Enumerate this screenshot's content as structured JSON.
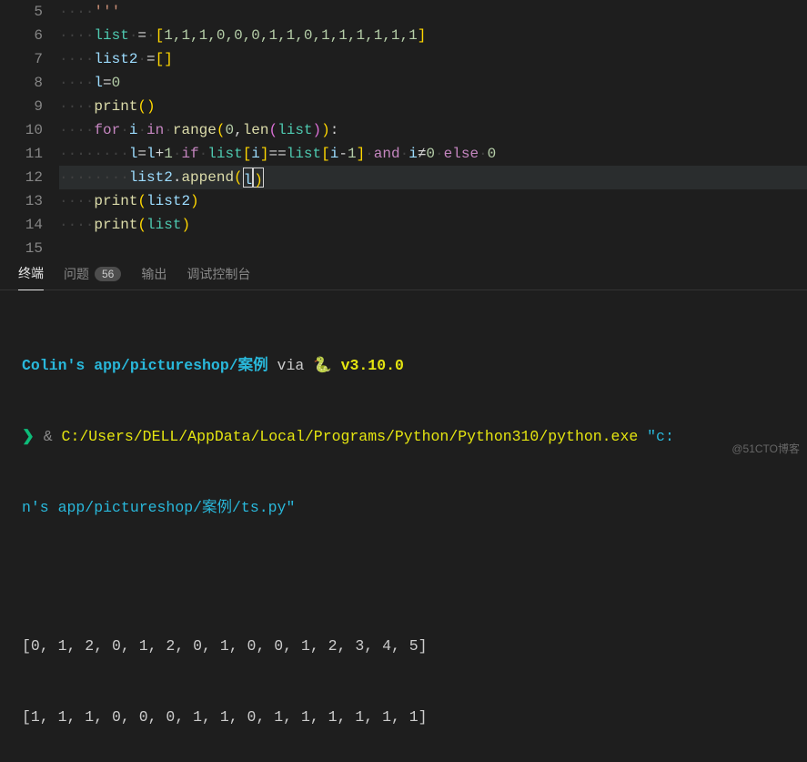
{
  "gutter": [
    "5",
    "6",
    "7",
    "8",
    "9",
    "10",
    "11",
    "12",
    "13",
    "14",
    "15"
  ],
  "code": {
    "l5": "'''",
    "l6_list": "list",
    "l6_items": "1,1,1,0,0,0,1,1,0,1,1,1,1,1,1",
    "l7_list2": "list2",
    "l8_l": "l",
    "l8_zero": "0",
    "l9_print": "print",
    "l10_for": "for",
    "l10_i": "i",
    "l10_in": "in",
    "l10_range": "range",
    "l10_len": "len",
    "l10_list": "list",
    "l10_zero": "0",
    "l11_l": "l",
    "l11_one": "1",
    "l11_if": "if",
    "l11_list": "list",
    "l11_i": "i",
    "l11_and": "and",
    "l11_else": "else",
    "l11_zero": "0",
    "l12_list2": "list2",
    "l12_append": "append",
    "l12_l": "l",
    "l13_print": "print",
    "l13_list2": "list2",
    "l14_print": "print",
    "l14_list": "list"
  },
  "tabs": {
    "terminal": "终端",
    "problems": "问题",
    "badge": "56",
    "output": "输出",
    "debug": "调试控制台"
  },
  "term": {
    "path": "Colin's app/pictureshop/案例",
    "via": " via ",
    "pyicon": "🐍",
    "version": " v3.10.0",
    "prompt": "❯ ",
    "amp": "& ",
    "exe": "C:/Users/DELL/AppData/Local/Programs/Python/Python310/python.exe",
    "argq": " \"c:",
    "arg2": "n's app/pictureshop/案例/ts.py\"",
    "out1": "[0, 1, 2, 0, 1, 2, 0, 1, 0, 0, 1, 2, 3, 4, 5]",
    "out2": "[1, 1, 1, 0, 0, 0, 1, 1, 0, 1, 1, 1, 1, 1, 1]"
  },
  "watermark": "@51CTO博客"
}
